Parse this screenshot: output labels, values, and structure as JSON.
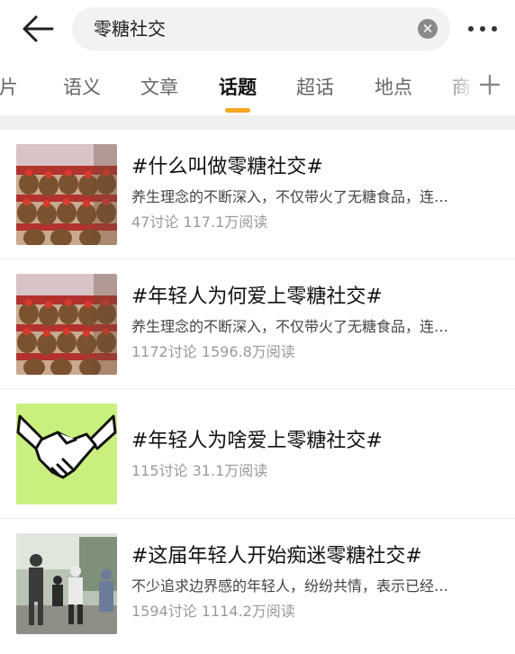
{
  "search": {
    "query": "零糖社交"
  },
  "tabs": [
    {
      "label": "图片"
    },
    {
      "label": "语义"
    },
    {
      "label": "文章"
    },
    {
      "label": "话题"
    },
    {
      "label": "超话"
    },
    {
      "label": "地点"
    },
    {
      "label": "商"
    }
  ],
  "active_tab": "话题",
  "topics": [
    {
      "title": "#什么叫做零糖社交#",
      "desc": "养生理念的不断深入，不仅带火了无糖食品，连…",
      "stats": "47讨论 117.1万阅读",
      "thumb": "plush-toys"
    },
    {
      "title": "#年轻人为何爱上零糖社交#",
      "desc": "养生理念的不断深入，不仅带火了无糖食品，连…",
      "stats": "1172讨论 1596.8万阅读",
      "thumb": "plush-toys"
    },
    {
      "title": "#年轻人为啥爱上零糖社交#",
      "desc": "",
      "stats": "115讨论 31.1万阅读",
      "thumb": "handshake"
    },
    {
      "title": "#这届年轻人开始痴迷零糖社交#",
      "desc": "不少追求边界感的年轻人，纷纷共情，表示已经…",
      "stats": "1594讨论 1114.2万阅读",
      "thumb": "people-photo"
    }
  ],
  "colors": {
    "accent": "#f5a623",
    "handshake_bg": "#c9ef7e"
  }
}
